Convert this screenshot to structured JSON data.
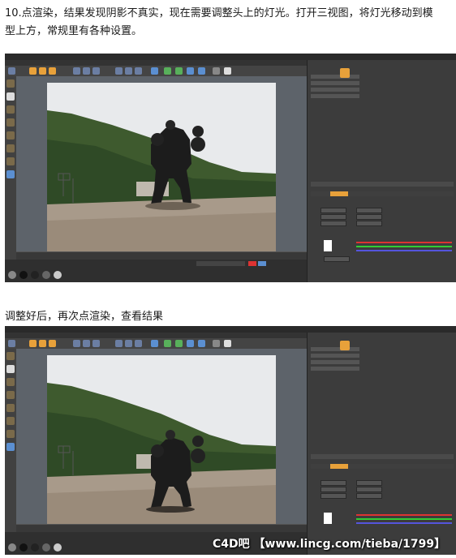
{
  "step_text_1_line1": "10.点渲染，结果发现阴影不真实，现在需要调整头上的灯光。打开三视图，将灯光移动到模",
  "step_text_1_line2": "型上方，常规里有各种设置。",
  "step_text_2": "调整好后，再次点渲染，查看结果",
  "watermark": "C4D吧 【www.lincg.com/tieba/1799】",
  "colors": {
    "accent": "#e8a13a",
    "slider_red": "#d33",
    "slider_green": "#3c3",
    "slider_blue": "#55d",
    "viewport": "#5d636a"
  }
}
